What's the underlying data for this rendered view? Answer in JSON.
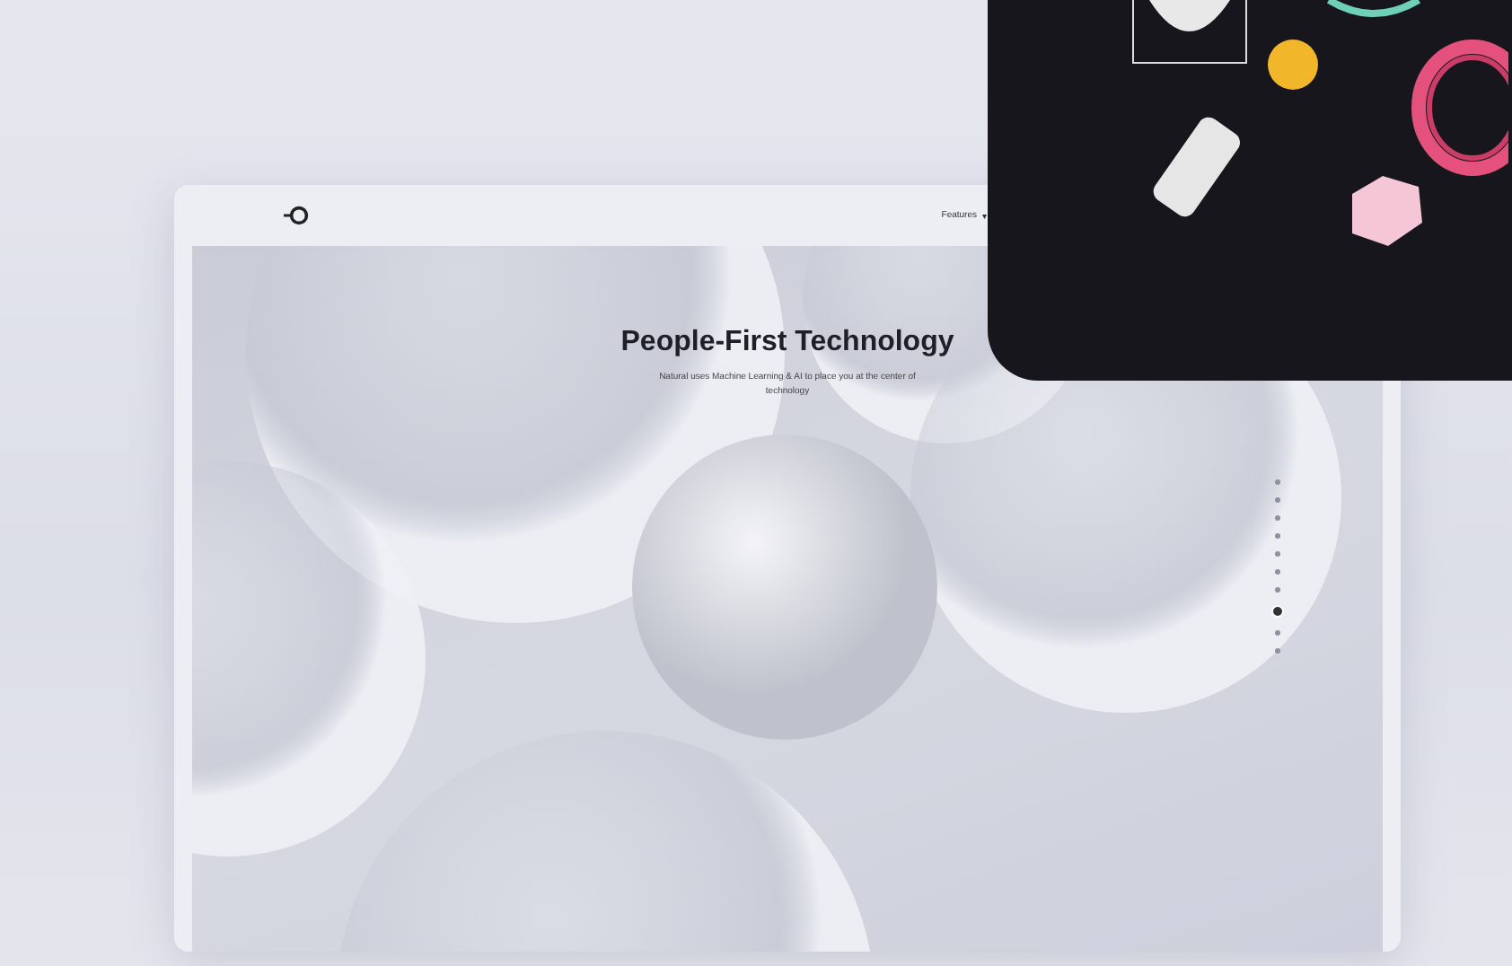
{
  "nav": {
    "menu_label": "Features",
    "menu_caret": "▾"
  },
  "hero": {
    "title": "People-First Technology",
    "subtitle": "Natural uses Machine Learning & AI to place you at the center of technology"
  },
  "slide_dots": [
    {
      "selected": false
    },
    {
      "selected": false
    },
    {
      "selected": false
    },
    {
      "selected": false
    },
    {
      "selected": false
    },
    {
      "selected": false
    },
    {
      "selected": false
    },
    {
      "selected": true
    },
    {
      "selected": false
    },
    {
      "selected": false
    }
  ]
}
